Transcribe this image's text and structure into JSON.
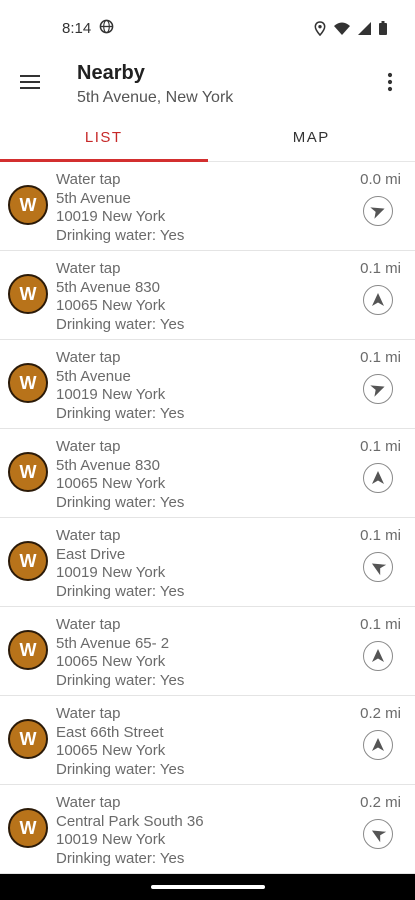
{
  "status_bar": {
    "time": "8:14"
  },
  "header": {
    "title": "Nearby",
    "subtitle": "5th Avenue, New York"
  },
  "tabs": [
    {
      "label": "LIST",
      "active": true
    },
    {
      "label": "MAP",
      "active": false
    }
  ],
  "colors": {
    "accent": "#d32f2f",
    "marker": "#b8731a",
    "marker_border": "#2b1a08"
  },
  "icons": {
    "menu": "hamburger-icon",
    "overflow": "more-vert-icon",
    "marker": "water-tap-marker",
    "direction": "navigation-arrow-icon"
  },
  "items": [
    {
      "badge": "W",
      "name": "Water tap",
      "street": "5th Avenue",
      "city": "10019 New York",
      "drinking": "Drinking water: Yes",
      "distance": "0.0 mi",
      "bearing_deg": 70
    },
    {
      "badge": "W",
      "name": "Water tap",
      "street": "5th Avenue 830",
      "city": "10065 New York",
      "drinking": "Drinking water: Yes",
      "distance": "0.1 mi",
      "bearing_deg": 0
    },
    {
      "badge": "W",
      "name": "Water tap",
      "street": "5th Avenue",
      "city": "10019 New York",
      "drinking": "Drinking water: Yes",
      "distance": "0.1 mi",
      "bearing_deg": 70
    },
    {
      "badge": "W",
      "name": "Water tap",
      "street": "5th Avenue 830",
      "city": "10065 New York",
      "drinking": "Drinking water: Yes",
      "distance": "0.1 mi",
      "bearing_deg": 0
    },
    {
      "badge": "W",
      "name": "Water tap",
      "street": "East Drive",
      "city": "10019 New York",
      "drinking": "Drinking water: Yes",
      "distance": "0.1 mi",
      "bearing_deg": 300
    },
    {
      "badge": "W",
      "name": "Water tap",
      "street": "5th Avenue 65- 2",
      "city": "10065 New York",
      "drinking": "Drinking water: Yes",
      "distance": "0.1 mi",
      "bearing_deg": 0
    },
    {
      "badge": "W",
      "name": "Water tap",
      "street": "East 66th Street",
      "city": "10065 New York",
      "drinking": "Drinking water: Yes",
      "distance": "0.2 mi",
      "bearing_deg": 0
    },
    {
      "badge": "W",
      "name": "Water tap",
      "street": "Central Park South 36",
      "city": "10019 New York",
      "drinking": "Drinking water: Yes",
      "distance": "0.2 mi",
      "bearing_deg": 300
    }
  ]
}
